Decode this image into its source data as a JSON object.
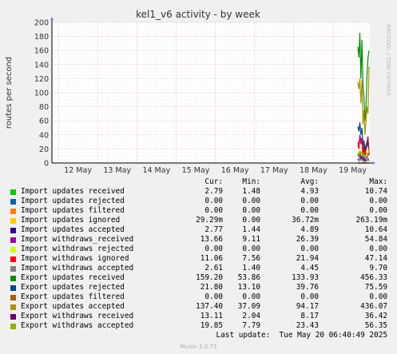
{
  "chart_data": {
    "type": "line",
    "title": "kel1_v6 activity - by week",
    "ylabel": "routes per second",
    "ylim": [
      0,
      200
    ],
    "yticks": [
      0,
      20,
      40,
      60,
      80,
      100,
      120,
      140,
      160,
      180,
      200
    ],
    "categories": [
      "12 May",
      "13 May",
      "14 May",
      "15 May",
      "16 May",
      "17 May",
      "18 May",
      "19 May"
    ],
    "grid": true,
    "side_label": "RRDTOOL / TOBI OETIKER",
    "series": [
      {
        "name": "Import updates received",
        "color": "#00cc00",
        "cur": "2.79",
        "min": "1.48",
        "avg": "4.93",
        "max": "10.74",
        "values": [
          6,
          3,
          7,
          4,
          9,
          3,
          5,
          2,
          4,
          3,
          6,
          3
        ]
      },
      {
        "name": "Import updates rejected",
        "color": "#0066b3",
        "cur": "0.00",
        "min": "0.00",
        "avg": "0.00",
        "max": "0.00",
        "values": [
          0,
          0,
          0,
          0,
          0,
          0,
          0,
          0,
          0,
          0,
          0,
          0
        ]
      },
      {
        "name": "Import updates filtered",
        "color": "#ff8000",
        "cur": "0.00",
        "min": "0.00",
        "avg": "0.00",
        "max": "0.00",
        "values": [
          0,
          0,
          0,
          0,
          0,
          0,
          0,
          0,
          0,
          0,
          0,
          0
        ]
      },
      {
        "name": "Import updates ignored",
        "color": "#ffcc00",
        "cur": "29.29m",
        "min": "0.00",
        "avg": "36.72m",
        "max": "263.19m",
        "values": [
          0,
          0,
          0.2,
          0,
          0,
          0.1,
          0,
          0,
          0,
          0.2,
          0,
          0
        ]
      },
      {
        "name": "Import updates accepted",
        "color": "#330099",
        "cur": "2.77",
        "min": "1.44",
        "avg": "4.89",
        "max": "10.64",
        "values": [
          6,
          3,
          7,
          4,
          9,
          3,
          5,
          2,
          4,
          3,
          6,
          3
        ]
      },
      {
        "name": "Import withdraws_received",
        "color": "#990099",
        "cur": "13.66",
        "min": "9.11",
        "avg": "26.39",
        "max": "54.84",
        "values": [
          30,
          25,
          40,
          32,
          35,
          12,
          28,
          10,
          22,
          30,
          38,
          14
        ]
      },
      {
        "name": "Import withdraws rejected",
        "color": "#ccff00",
        "cur": "0.00",
        "min": "0.00",
        "avg": "0.00",
        "max": "0.00",
        "values": [
          0,
          0,
          0,
          0,
          0,
          0,
          0,
          0,
          0,
          0,
          0,
          0
        ]
      },
      {
        "name": "Import withdraws ignored",
        "color": "#ff0000",
        "cur": "11.06",
        "min": "7.56",
        "avg": "21.94",
        "max": "47.14",
        "values": [
          26,
          20,
          35,
          28,
          31,
          10,
          24,
          8,
          19,
          26,
          33,
          11
        ]
      },
      {
        "name": "Import withdraws accepted",
        "color": "#808080",
        "cur": "2.61",
        "min": "1.40",
        "avg": "4.45",
        "max": "9.70",
        "values": [
          5,
          3,
          6,
          4,
          8,
          2,
          5,
          2,
          4,
          3,
          5,
          3
        ]
      },
      {
        "name": "Export updates received",
        "color": "#008f00",
        "cur": "159.20",
        "min": "53.86",
        "avg": "133.93",
        "max": "456.33",
        "values": [
          165,
          150,
          185,
          120,
          175,
          110,
          95,
          60,
          80,
          125,
          150,
          160
        ]
      },
      {
        "name": "Export updates rejected",
        "color": "#00487d",
        "cur": "21.80",
        "min": "13.10",
        "avg": "39.76",
        "max": "75.59",
        "values": [
          52,
          45,
          58,
          40,
          50,
          25,
          32,
          18,
          26,
          30,
          24,
          22
        ]
      },
      {
        "name": "Export updates filtered",
        "color": "#b35a00",
        "cur": "0.00",
        "min": "0.00",
        "avg": "0.00",
        "max": "0.00",
        "values": [
          0,
          0,
          0,
          0,
          0,
          0,
          0,
          0,
          0,
          0,
          0,
          0
        ]
      },
      {
        "name": "Export updates accepted",
        "color": "#b38f00",
        "cur": "137.40",
        "min": "37.09",
        "avg": "94.17",
        "max": "436.07",
        "values": [
          115,
          105,
          120,
          85,
          118,
          55,
          75,
          40,
          60,
          80,
          70,
          137
        ]
      },
      {
        "name": "Export withdraws received",
        "color": "#6b006b",
        "cur": "13.11",
        "min": "2.04",
        "avg": "8.17",
        "max": "36.42",
        "values": [
          12,
          9,
          14,
          7,
          10,
          5,
          8,
          3,
          6,
          9,
          11,
          13
        ]
      },
      {
        "name": "Export withdraws accepted",
        "color": "#8fb300",
        "cur": "19.85",
        "min": "7.79",
        "avg": "23.43",
        "max": "56.35",
        "values": [
          15,
          10,
          18,
          12,
          16,
          9,
          13,
          8,
          12,
          14,
          11,
          20
        ]
      }
    ]
  },
  "legend_headers": {
    "cur": "Cur:",
    "min": "Min:",
    "avg": "Avg:",
    "max": "Max:"
  },
  "last_update": "Last update:  Tue May 20 06:40:49 2025",
  "footer": "Munin 2.0.73"
}
